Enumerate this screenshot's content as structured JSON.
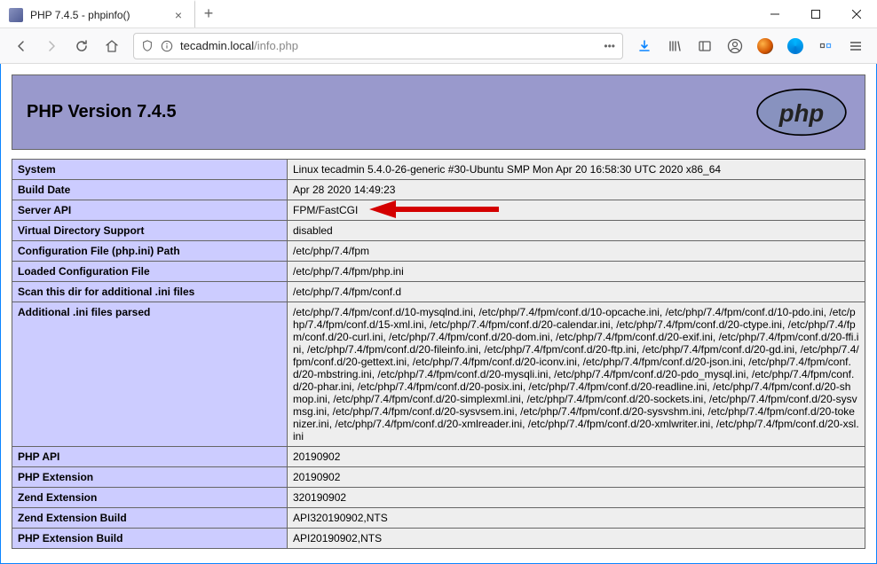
{
  "browser": {
    "tab_title": "PHP 7.4.5 - phpinfo()",
    "url_host": "tecadmin.local",
    "url_path": "/info.php"
  },
  "page": {
    "header_title": "PHP Version 7.4.5",
    "rows": [
      {
        "key": "System",
        "value": "Linux tecadmin 5.4.0-26-generic #30-Ubuntu SMP Mon Apr 20 16:58:30 UTC 2020 x86_64"
      },
      {
        "key": "Build Date",
        "value": "Apr 28 2020 14:49:23"
      },
      {
        "key": "Server API",
        "value": "FPM/FastCGI",
        "highlight": true
      },
      {
        "key": "Virtual Directory Support",
        "value": "disabled"
      },
      {
        "key": "Configuration File (php.ini) Path",
        "value": "/etc/php/7.4/fpm"
      },
      {
        "key": "Loaded Configuration File",
        "value": "/etc/php/7.4/fpm/php.ini"
      },
      {
        "key": "Scan this dir for additional .ini files",
        "value": "/etc/php/7.4/fpm/conf.d"
      },
      {
        "key": "Additional .ini files parsed",
        "value": "/etc/php/7.4/fpm/conf.d/10-mysqlnd.ini, /etc/php/7.4/fpm/conf.d/10-opcache.ini, /etc/php/7.4/fpm/conf.d/10-pdo.ini, /etc/php/7.4/fpm/conf.d/15-xml.ini, /etc/php/7.4/fpm/conf.d/20-calendar.ini, /etc/php/7.4/fpm/conf.d/20-ctype.ini, /etc/php/7.4/fpm/conf.d/20-curl.ini, /etc/php/7.4/fpm/conf.d/20-dom.ini, /etc/php/7.4/fpm/conf.d/20-exif.ini, /etc/php/7.4/fpm/conf.d/20-ffi.ini, /etc/php/7.4/fpm/conf.d/20-fileinfo.ini, /etc/php/7.4/fpm/conf.d/20-ftp.ini, /etc/php/7.4/fpm/conf.d/20-gd.ini, /etc/php/7.4/fpm/conf.d/20-gettext.ini, /etc/php/7.4/fpm/conf.d/20-iconv.ini, /etc/php/7.4/fpm/conf.d/20-json.ini, /etc/php/7.4/fpm/conf.d/20-mbstring.ini, /etc/php/7.4/fpm/conf.d/20-mysqli.ini, /etc/php/7.4/fpm/conf.d/20-pdo_mysql.ini, /etc/php/7.4/fpm/conf.d/20-phar.ini, /etc/php/7.4/fpm/conf.d/20-posix.ini, /etc/php/7.4/fpm/conf.d/20-readline.ini, /etc/php/7.4/fpm/conf.d/20-shmop.ini, /etc/php/7.4/fpm/conf.d/20-simplexml.ini, /etc/php/7.4/fpm/conf.d/20-sockets.ini, /etc/php/7.4/fpm/conf.d/20-sysvmsg.ini, /etc/php/7.4/fpm/conf.d/20-sysvsem.ini, /etc/php/7.4/fpm/conf.d/20-sysvshm.ini, /etc/php/7.4/fpm/conf.d/20-tokenizer.ini, /etc/php/7.4/fpm/conf.d/20-xmlreader.ini, /etc/php/7.4/fpm/conf.d/20-xmlwriter.ini, /etc/php/7.4/fpm/conf.d/20-xsl.ini"
      },
      {
        "key": "PHP API",
        "value": "20190902"
      },
      {
        "key": "PHP Extension",
        "value": "20190902"
      },
      {
        "key": "Zend Extension",
        "value": "320190902"
      },
      {
        "key": "Zend Extension Build",
        "value": "API320190902,NTS"
      },
      {
        "key": "PHP Extension Build",
        "value": "API20190902,NTS"
      }
    ]
  }
}
